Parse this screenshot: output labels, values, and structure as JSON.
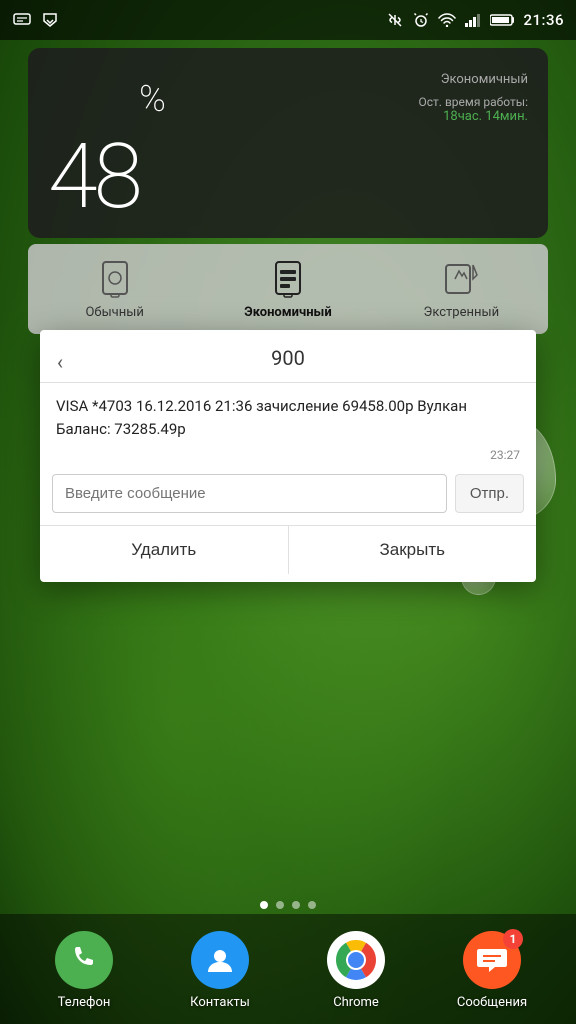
{
  "statusBar": {
    "time": "21:36",
    "icons": [
      "message",
      "pocket",
      "mute",
      "alarm",
      "wifi",
      "signal",
      "battery"
    ]
  },
  "batteryWidget": {
    "percent": "48",
    "percentSymbol": "%",
    "modeLabel": "Экономичный",
    "remainingLabel": "Ост. время работы:",
    "remainingValue": "18час. 14мин."
  },
  "modeSelector": {
    "modes": [
      {
        "label": "Обычный",
        "active": false
      },
      {
        "label": "Экономичный",
        "active": true
      },
      {
        "label": "Экстренный",
        "active": false
      }
    ]
  },
  "smsDialog": {
    "title": "900",
    "message": "VISA *4703 16.12.2016 21:36 зачисление 69458.00р Вулкан Баланс: 73285.49р",
    "timestamp": "23:27",
    "inputPlaceholder": "Введите сообщение",
    "sendLabel": "Отпр.",
    "deleteLabel": "Удалить",
    "closeLabel": "Закрыть"
  },
  "pageDots": {
    "count": 4,
    "active": 0
  },
  "dock": {
    "items": [
      {
        "label": "Телефон",
        "icon": "phone"
      },
      {
        "label": "Контакты",
        "icon": "contacts"
      },
      {
        "label": "Chrome",
        "icon": "chrome"
      },
      {
        "label": "Сообщения",
        "icon": "messages",
        "badge": "1"
      }
    ]
  }
}
